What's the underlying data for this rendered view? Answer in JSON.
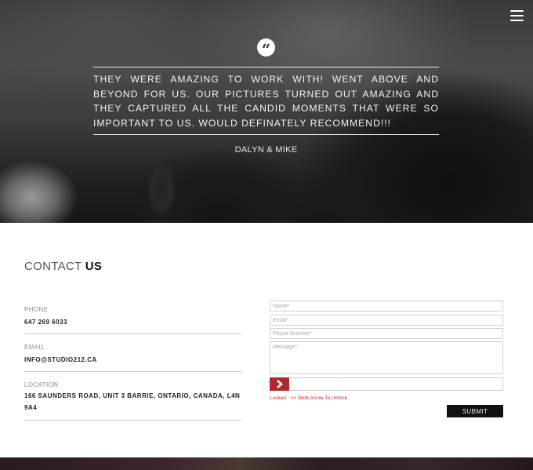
{
  "hero": {
    "quote_text": "They were amazing to work with! Went above and beyond for us. Our pictures turned out amazing and they captured all the candid moments that were so important to us. Would definately recommend!!!",
    "author": "Dalyn & Mike",
    "quote_icon": "quote-icon",
    "menu_icon": "hamburger-menu-icon"
  },
  "contact": {
    "title_light": "CONTACT",
    "title_bold": "US",
    "phone_label": "PHONE",
    "phone_value": "647 269 6033",
    "email_label": "EMAIL",
    "email_value": "INFO@STUDIO212.CA",
    "location_label": "LOCATION",
    "location_value": "166 SAUNDERS ROAD, UNIT 3 BARRIE, ONTARIO, CANADA, L4N 9A4"
  },
  "form": {
    "name_placeholder": "Name*",
    "email_placeholder": "Email*",
    "phone_placeholder": "Phone Number*",
    "message_placeholder": "Message*",
    "lock_text": "Locked : >> Slide Arrow To Unlock.",
    "submit_label": "SUBMIT",
    "accent_color": "#b3262a"
  }
}
